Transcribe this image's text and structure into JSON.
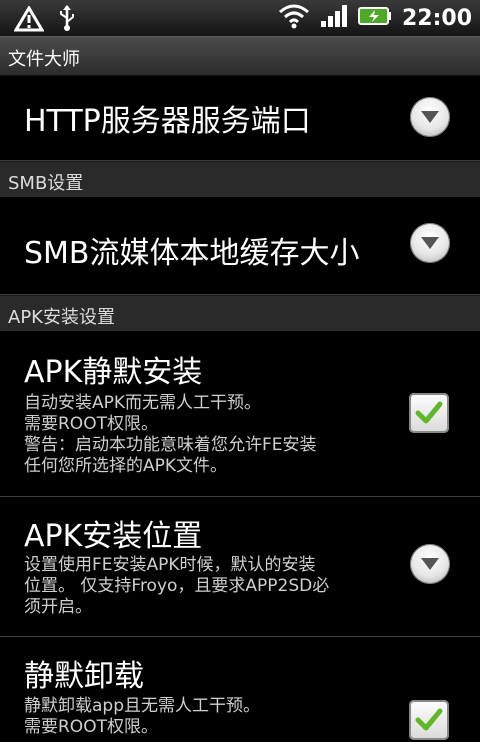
{
  "status_bar": {
    "time": "22:00",
    "icons": [
      "warning-icon",
      "usb-icon",
      "wifi-icon",
      "signal-icon",
      "battery-charging-icon"
    ]
  },
  "title_bar": {
    "title": "文件大师"
  },
  "settings": {
    "http_port": {
      "title": "HTTP服务器服务端口",
      "control": "dropdown"
    },
    "smb_section": {
      "label": "SMB设置"
    },
    "smb_cache": {
      "title": "SMB流媒体本地缓存大小",
      "control": "dropdown"
    },
    "apk_section": {
      "label": "APK安装设置"
    },
    "apk_silent": {
      "title": "APK静默安装",
      "desc": [
        "自动安装APK而无需人工干预。",
        "需要ROOT权限。",
        "警告：启动本功能意味着您允许FE安装",
        "任何您所选择的APK文件。"
      ],
      "checked": true
    },
    "apk_location": {
      "title": "APK安装位置",
      "desc": [
        "设置使用FE安装APK时候，默认的安装",
        "位置。 仅支持Froyo，且要求APP2SD必",
        "须开启。"
      ],
      "control": "dropdown"
    },
    "silent_uninstall": {
      "title": "静默卸载",
      "desc": [
        "静默卸载app且无需人工干预。",
        "需要ROOT权限。"
      ],
      "checked": true
    }
  }
}
